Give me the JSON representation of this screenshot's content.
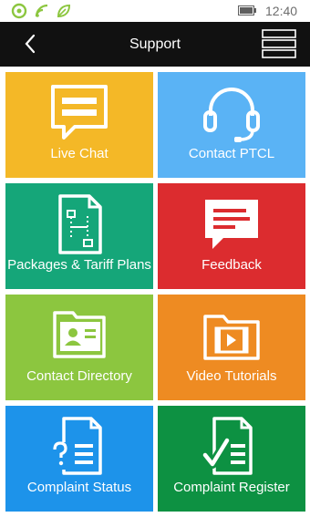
{
  "status_bar": {
    "time": "12:40",
    "icons": [
      "app-notification-icon",
      "wifi-signal-icon",
      "leaf-icon",
      "battery-icon"
    ]
  },
  "app_bar": {
    "title": "Support",
    "back_icon": "chevron-left-icon",
    "menu_icon": "list-menu-icon"
  },
  "tiles": [
    {
      "label": "Live Chat",
      "icon": "chat-bubble-icon",
      "color": "#f4b827"
    },
    {
      "label": "Contact PTCL",
      "icon": "headset-icon",
      "color": "#5ab3f5"
    },
    {
      "label": "Packages & Tariff Plans",
      "icon": "flow-chart-document-icon",
      "color": "#15a679"
    },
    {
      "label": "Feedback",
      "icon": "feedback-message-icon",
      "color": "#dc2c2f"
    },
    {
      "label": "Contact Directory",
      "icon": "contact-card-icon",
      "color": "#8cc63f"
    },
    {
      "label": "Video Tutorials",
      "icon": "video-folder-icon",
      "color": "#ee8b22"
    },
    {
      "label": "Complaint Status",
      "icon": "question-document-icon",
      "color": "#1d93ea"
    },
    {
      "label": "Complaint Register",
      "icon": "checkmark-document-icon",
      "color": "#0d9142"
    }
  ]
}
